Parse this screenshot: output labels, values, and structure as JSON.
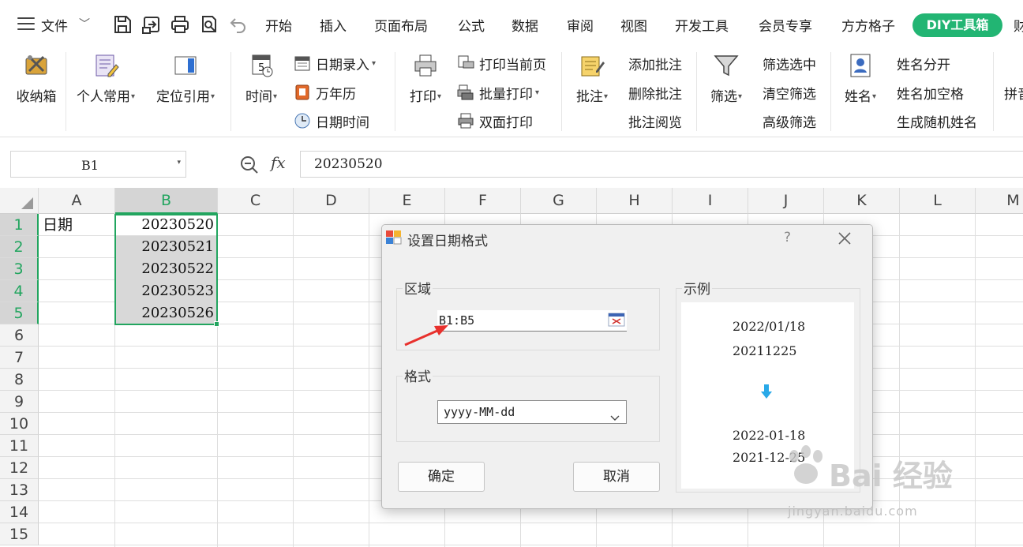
{
  "menu": {
    "file_label": "文件",
    "tabs": [
      "开始",
      "插入",
      "页面布局",
      "公式",
      "数据",
      "审阅",
      "视图",
      "开发工具",
      "会员专享",
      "方方格子"
    ],
    "active_tab": "DIY工具箱",
    "overflow_char": "财"
  },
  "quick_access": [
    "save-icon",
    "export-icon",
    "print-icon",
    "print-preview-icon",
    "undo-icon"
  ],
  "ribbon": {
    "storage_box": "收纳箱",
    "personal_common": "个人常用",
    "locate_ref": "定位引用",
    "time": "时间",
    "date_entry": "日期录入",
    "perpetual_calendar": "万年历",
    "date_time": "日期时间",
    "print": "打印",
    "print_current_page": "打印当前页",
    "batch_print": "批量打印",
    "duplex_print": "双面打印",
    "comment": "批注",
    "add_comment": "添加批注",
    "delete_comment": "删除批注",
    "comment_review": "批注阅览",
    "filter": "筛选",
    "filter_selected": "筛选选中",
    "clear_filter": "清空筛选",
    "advanced_filter": "高级筛选",
    "name": "姓名",
    "name_split": "姓名分开",
    "name_add_space": "姓名加空格",
    "random_name": "生成随机姓名",
    "pinyin_cut": "拼音"
  },
  "formula_bar": {
    "name_box": "B1",
    "fx": "fx",
    "value": "20230520"
  },
  "grid": {
    "columns": [
      "A",
      "B",
      "C",
      "D",
      "E",
      "F",
      "G",
      "H",
      "I",
      "J",
      "K",
      "L",
      "M"
    ],
    "rows": [
      "1",
      "2",
      "3",
      "4",
      "5",
      "6",
      "7",
      "8",
      "9",
      "10",
      "11",
      "12",
      "13",
      "14",
      "15"
    ],
    "cells": {
      "A1": "日期",
      "B1": "20230520",
      "B2": "20230521",
      "B3": "20230522",
      "B4": "20230523",
      "B5": "20230526"
    }
  },
  "dialog": {
    "title": "设置日期格式",
    "help": "?",
    "region_label": "区域",
    "region_value": "B1:B5",
    "format_label": "格式",
    "format_value": "yyyy-MM-dd",
    "example_label": "示例",
    "example_before": [
      "2022/01/18",
      "20211225"
    ],
    "example_after": [
      "2022-01-18",
      "2021-12-25"
    ],
    "ok": "确定",
    "cancel": "取消"
  },
  "watermark": {
    "brand": "Bai 经验",
    "site": "jingyan.baidu.com"
  },
  "colors": {
    "accent_green": "#22b573",
    "selection_green": "#22a55f",
    "annotation_red": "#e8312d",
    "arrow_blue": "#29a9e8"
  }
}
